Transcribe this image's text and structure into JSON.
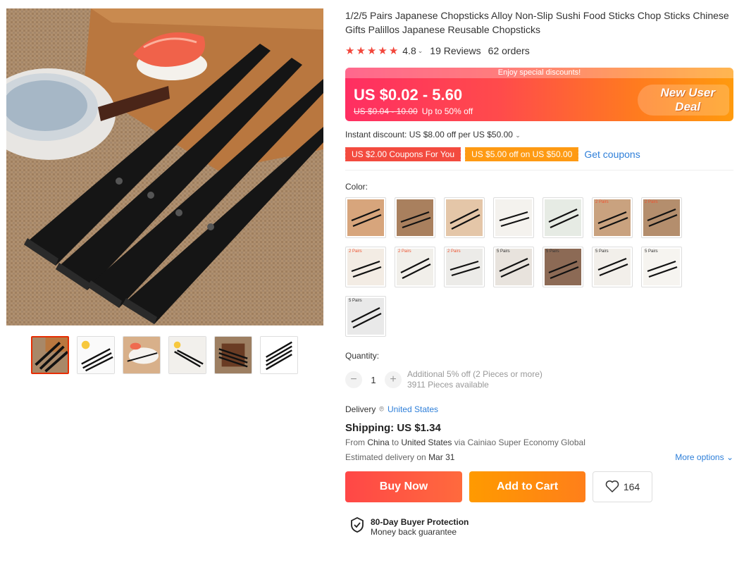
{
  "product": {
    "title": "1/2/5 Pairs Japanese Chopsticks Alloy Non-Slip Sushi Food Sticks Chop Sticks Chinese Gifts Palillos Japanese Reusable Chopsticks",
    "rating": "4.8",
    "reviews": "19 Reviews",
    "orders": "62 orders",
    "star_count": 5
  },
  "price": {
    "promo_strip": "Enjoy special discounts!",
    "range": "US $0.02 - 5.60",
    "original": "US $0.04 - 10.00",
    "discount": "Up to 50% off",
    "badge_line1": "New User",
    "badge_line2": "Deal"
  },
  "instant_discount": "Instant discount: US $8.00 off per US $50.00",
  "coupons": {
    "coupon1": "US $2.00 Coupons For You",
    "coupon2": "US $5.00 off on US $50.00",
    "get_label": "Get coupons"
  },
  "color": {
    "label": "Color:",
    "options": [
      {
        "tag": ""
      },
      {
        "tag": ""
      },
      {
        "tag": ""
      },
      {
        "tag": ""
      },
      {
        "tag": ""
      },
      {
        "tag": "2 Pairs"
      },
      {
        "tag": "2 Pairs"
      },
      {
        "tag": "2 Pairs"
      },
      {
        "tag": "2 Pairs"
      },
      {
        "tag": "2 Pairs"
      },
      {
        "tag": "5 Pairs"
      },
      {
        "tag": "5 Pairs"
      },
      {
        "tag": "5 Pairs"
      },
      {
        "tag": "5 Pairs"
      },
      {
        "tag": "5 Pairs"
      }
    ]
  },
  "quantity": {
    "label": "Quantity:",
    "value": "1",
    "note_line1": "Additional 5% off (2 Pieces or more)",
    "note_line2": "3911 Pieces available"
  },
  "delivery": {
    "label": "Delivery",
    "location": "United States"
  },
  "shipping": {
    "title": "Shipping: US $1.34",
    "from_prefix": "From ",
    "from": "China",
    "to_prefix": " to ",
    "to": "United States",
    "via": " via Cainiao Super Economy Global",
    "eta_prefix": "Estimated delivery on ",
    "eta": "Mar 31",
    "more_options": "More options"
  },
  "actions": {
    "buy_now": "Buy Now",
    "add_to_cart": "Add to Cart",
    "wishlist_count": "164"
  },
  "protection": {
    "title": "80-Day Buyer Protection",
    "subtitle": "Money back guarantee"
  },
  "colors": {
    "price_gradient_start": "#ff2e62",
    "price_gradient_end": "#ff9a0e",
    "buy_now": "#ff4747",
    "add_to_cart": "#ff9a00",
    "link": "#2e7fd9",
    "star": "#f2463b",
    "thumb_active_border": "#e62e04"
  }
}
